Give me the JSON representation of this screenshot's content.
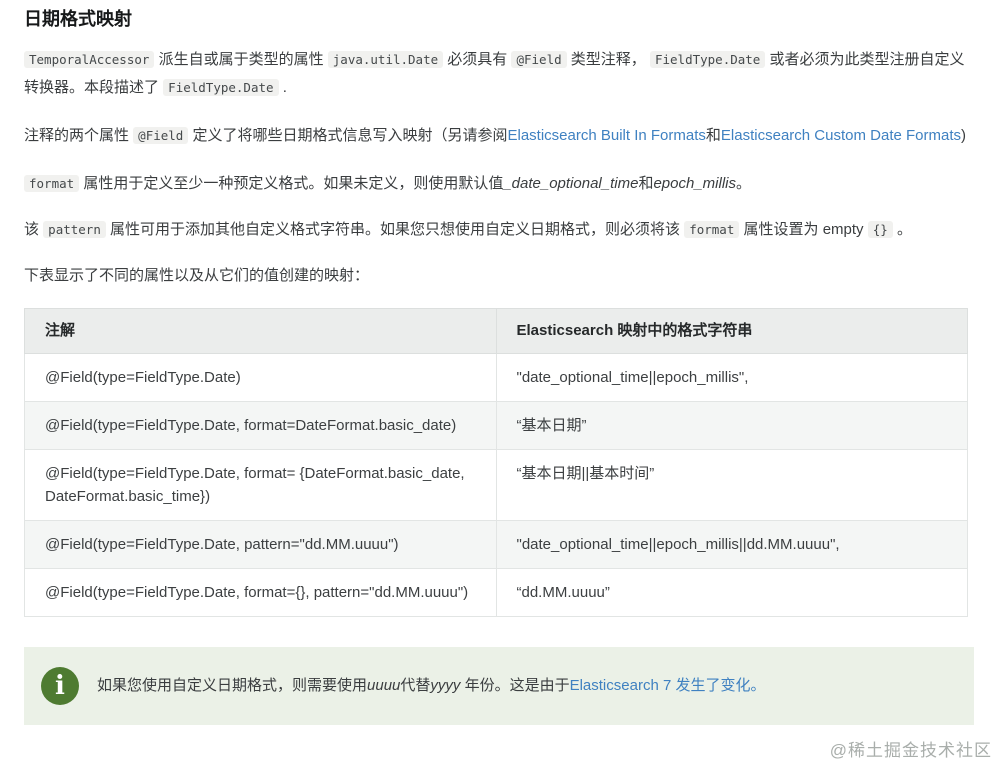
{
  "page": {
    "title": "日期格式映射",
    "watermark": "@稀土掘金技术社区"
  },
  "p1": {
    "code1": "TemporalAccessor",
    "t1": " 派生自或属于类型的属性 ",
    "code2": "java.util.Date",
    "t2": " 必须具有 ",
    "code3": "@Field",
    "t3": " 类型注释， ",
    "code4": "FieldType.Date",
    "t4": " 或者必须为此类型注册自定义转换器。本段描述了 ",
    "code5": "FieldType.Date",
    "t5": " ."
  },
  "p2": {
    "t1": "注释的两个属性 ",
    "code1": "@Field",
    "t2": " 定义了将哪些日期格式信息写入映射（另请参阅",
    "link1": "Elasticsearch Built In Formats",
    "t3": "和",
    "link2": "Elasticsearch Custom Date Formats",
    "t4": ")"
  },
  "p3": {
    "code1": "format",
    "t1": " 属性用于定义至少一种预定义格式。如果未定义，则使用默认值",
    "em1": "_date_optional_time",
    "t2": "和",
    "em2": "epoch_millis",
    "t3": "。"
  },
  "p4": {
    "t1": "该 ",
    "code1": "pattern",
    "t2": " 属性可用于添加其他自定义格式字符串。如果您只想使用自定义日期格式，则必须将该 ",
    "code2": "format",
    "t3": " 属性设置为 empty ",
    "code3": "{}",
    "t4": " 。"
  },
  "p5": {
    "t1": "下表显示了不同的属性以及从它们的值创建的映射："
  },
  "table": {
    "headers": [
      "注解",
      "Elasticsearch 映射中的格式字符串"
    ],
    "rows": [
      [
        "@Field(type=FieldType.Date)",
        "\"date_optional_time||epoch_millis\","
      ],
      [
        "@Field(type=FieldType.Date, format=DateFormat.basic_date)",
        "“基本日期”"
      ],
      [
        "@Field(type=FieldType.Date, format= {DateFormat.basic_date, DateFormat.basic_time})",
        "“基本日期||基本时间”"
      ],
      [
        "@Field(type=FieldType.Date, pattern=\"dd.MM.uuuu\")",
        "\"date_optional_time||epoch_millis||dd.MM.uuuu\","
      ],
      [
        "@Field(type=FieldType.Date, format={}, pattern=\"dd.MM.uuuu\")",
        "“dd.MM.uuuu”"
      ]
    ]
  },
  "note": {
    "icon_glyph": "i",
    "t1": "如果您使用自定义日期格式，则需要使用",
    "em1": "uuuu",
    "t2": "代替",
    "em2": "yyyy",
    "t3": " 年份。这是由于",
    "link1": "Elasticsearch 7 发生了变化。"
  },
  "colors": {
    "link": "#3f81c1",
    "note_bg": "#ebf1e7",
    "note_icon": "#4e7b31",
    "table_header_bg": "#ebedec",
    "stripe_bg": "#f4f6f5",
    "code_bg": "#f1f1ef"
  }
}
